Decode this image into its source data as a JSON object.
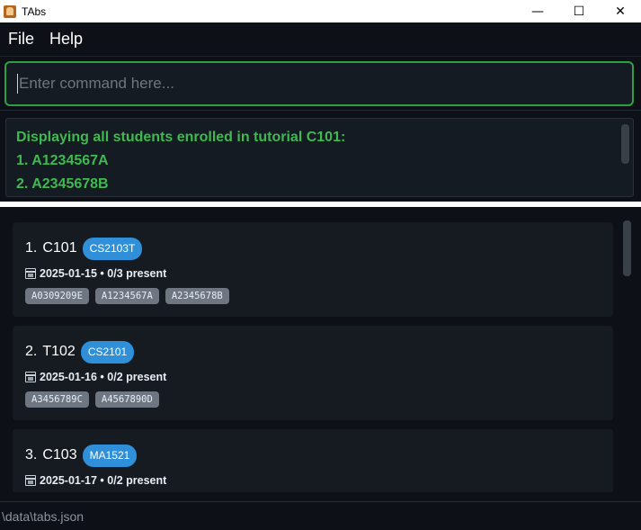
{
  "window": {
    "title": "TAbs",
    "minimize": "—",
    "maximize": "☐",
    "close": "✕"
  },
  "menu": {
    "items": [
      "File",
      "Help"
    ]
  },
  "command": {
    "placeholder": "Enter command here..."
  },
  "result": {
    "lines": [
      "Displaying all students enrolled in tutorial C101:",
      "1. A1234567A",
      "2. A2345678B"
    ]
  },
  "tutorials": [
    {
      "index": "1.",
      "code": "C101",
      "module": "CS2103T",
      "date": "2025-01-15",
      "attendance": "0/3 present",
      "students": [
        "A0309209E",
        "A1234567A",
        "A2345678B"
      ]
    },
    {
      "index": "2.",
      "code": "T102",
      "module": "CS2101",
      "date": "2025-01-16",
      "attendance": "0/2 present",
      "students": [
        "A3456789C",
        "A4567890D"
      ]
    },
    {
      "index": "3.",
      "code": "C103",
      "module": "MA1521",
      "date": "2025-01-17",
      "attendance": "0/2 present",
      "students": [
        "",
        ""
      ]
    }
  ],
  "status": {
    "path": "\\data\\tabs.json"
  },
  "colors": {
    "accent_green": "#2ea043",
    "result_text": "#3fb950",
    "badge_blue": "#2f8fd8",
    "background": "#0d1117"
  }
}
